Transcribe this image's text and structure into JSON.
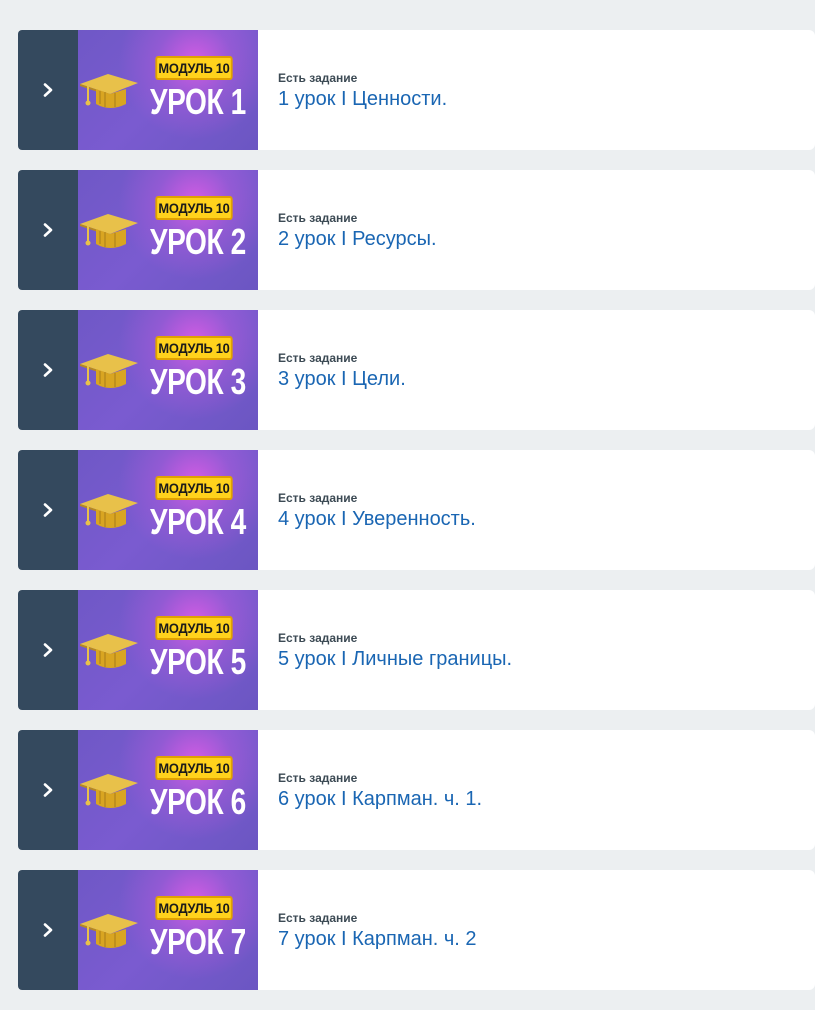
{
  "colors": {
    "toggle_bg": "#34495e",
    "thumb_bg": "#7359c8",
    "badge_bg": "#ffd21c",
    "link": "#1a66b3",
    "page_bg": "#eceff1"
  },
  "lessons": [
    {
      "module_badge": "МОДУЛЬ 10",
      "lesson_badge": "УРОК 1",
      "status": "Есть задание",
      "title": "1 урок I Ценности."
    },
    {
      "module_badge": "МОДУЛЬ 10",
      "lesson_badge": "УРОК 2",
      "status": "Есть задание",
      "title": "2 урок I Ресурсы."
    },
    {
      "module_badge": "МОДУЛЬ 10",
      "lesson_badge": "УРОК 3",
      "status": "Есть задание",
      "title": "3 урок I Цели."
    },
    {
      "module_badge": "МОДУЛЬ 10",
      "lesson_badge": "УРОК 4",
      "status": "Есть задание",
      "title": "4 урок I Уверенность."
    },
    {
      "module_badge": "МОДУЛЬ 10",
      "lesson_badge": "УРОК 5",
      "status": "Есть задание",
      "title": "5 урок I Личные границы."
    },
    {
      "module_badge": "МОДУЛЬ 10",
      "lesson_badge": "УРОК 6",
      "status": "Есть задание",
      "title": "6 урок I Карпман. ч. 1."
    },
    {
      "module_badge": "МОДУЛЬ 10",
      "lesson_badge": "УРОК 7",
      "status": "Есть задание",
      "title": "7 урок I Карпман. ч. 2"
    }
  ]
}
